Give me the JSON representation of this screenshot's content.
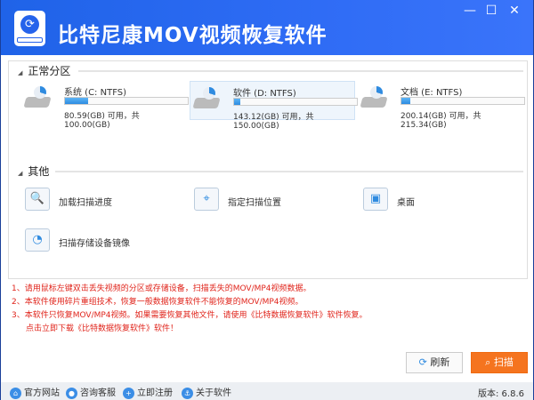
{
  "title": "比特尼康MOV视频恢复软件",
  "window": {
    "minimize": "—",
    "maximize": "☐",
    "close": "✕"
  },
  "sections": {
    "normal": "正常分区",
    "other": "其他"
  },
  "drives": [
    {
      "name": "系统 (C: NTFS)",
      "size": "80.59(GB) 可用，共 100.00(GB)",
      "used_fraction": 0.19
    },
    {
      "name": "软件 (D: NTFS)",
      "size": "143.12(GB) 可用，共 150.00(GB)",
      "used_fraction": 0.05,
      "selected": true
    },
    {
      "name": "文档 (E: NTFS)",
      "size": "200.14(GB) 可用，共 215.34(GB)",
      "used_fraction": 0.07
    }
  ],
  "other_items": [
    {
      "label": "加载扫描进度",
      "icon": "load-progress-icon"
    },
    {
      "label": "指定扫描位置",
      "icon": "folder-location-icon"
    },
    {
      "label": "桌面",
      "icon": "desktop-icon"
    },
    {
      "label": "扫描存储设备镜像",
      "icon": "disk-image-icon"
    }
  ],
  "notes": [
    "1、请用鼠标左键双击丢失视频的分区或存储设备，扫描丢失的MOV/MP4视频数据。",
    "2、本软件使用碎片重组技术，恢复一般数据恢复软件不能恢复的MOV/MP4视频。",
    "3、本软件只恢复MOV/MP4视频。如果需要恢复其他文件，请使用《比特数据恢复软件》软件恢复。",
    "点击立即下载《比特数据恢复软件》软件！"
  ],
  "buttons": {
    "refresh": "刷新",
    "scan": "扫描"
  },
  "footer": {
    "links": [
      "官方网站",
      "咨询客服",
      "立即注册",
      "关于软件"
    ],
    "version": "版本: 6.8.6"
  },
  "colors": {
    "titlebar": "#2f6cf5",
    "scan": "#f5741f",
    "notes": "#e0241b"
  }
}
